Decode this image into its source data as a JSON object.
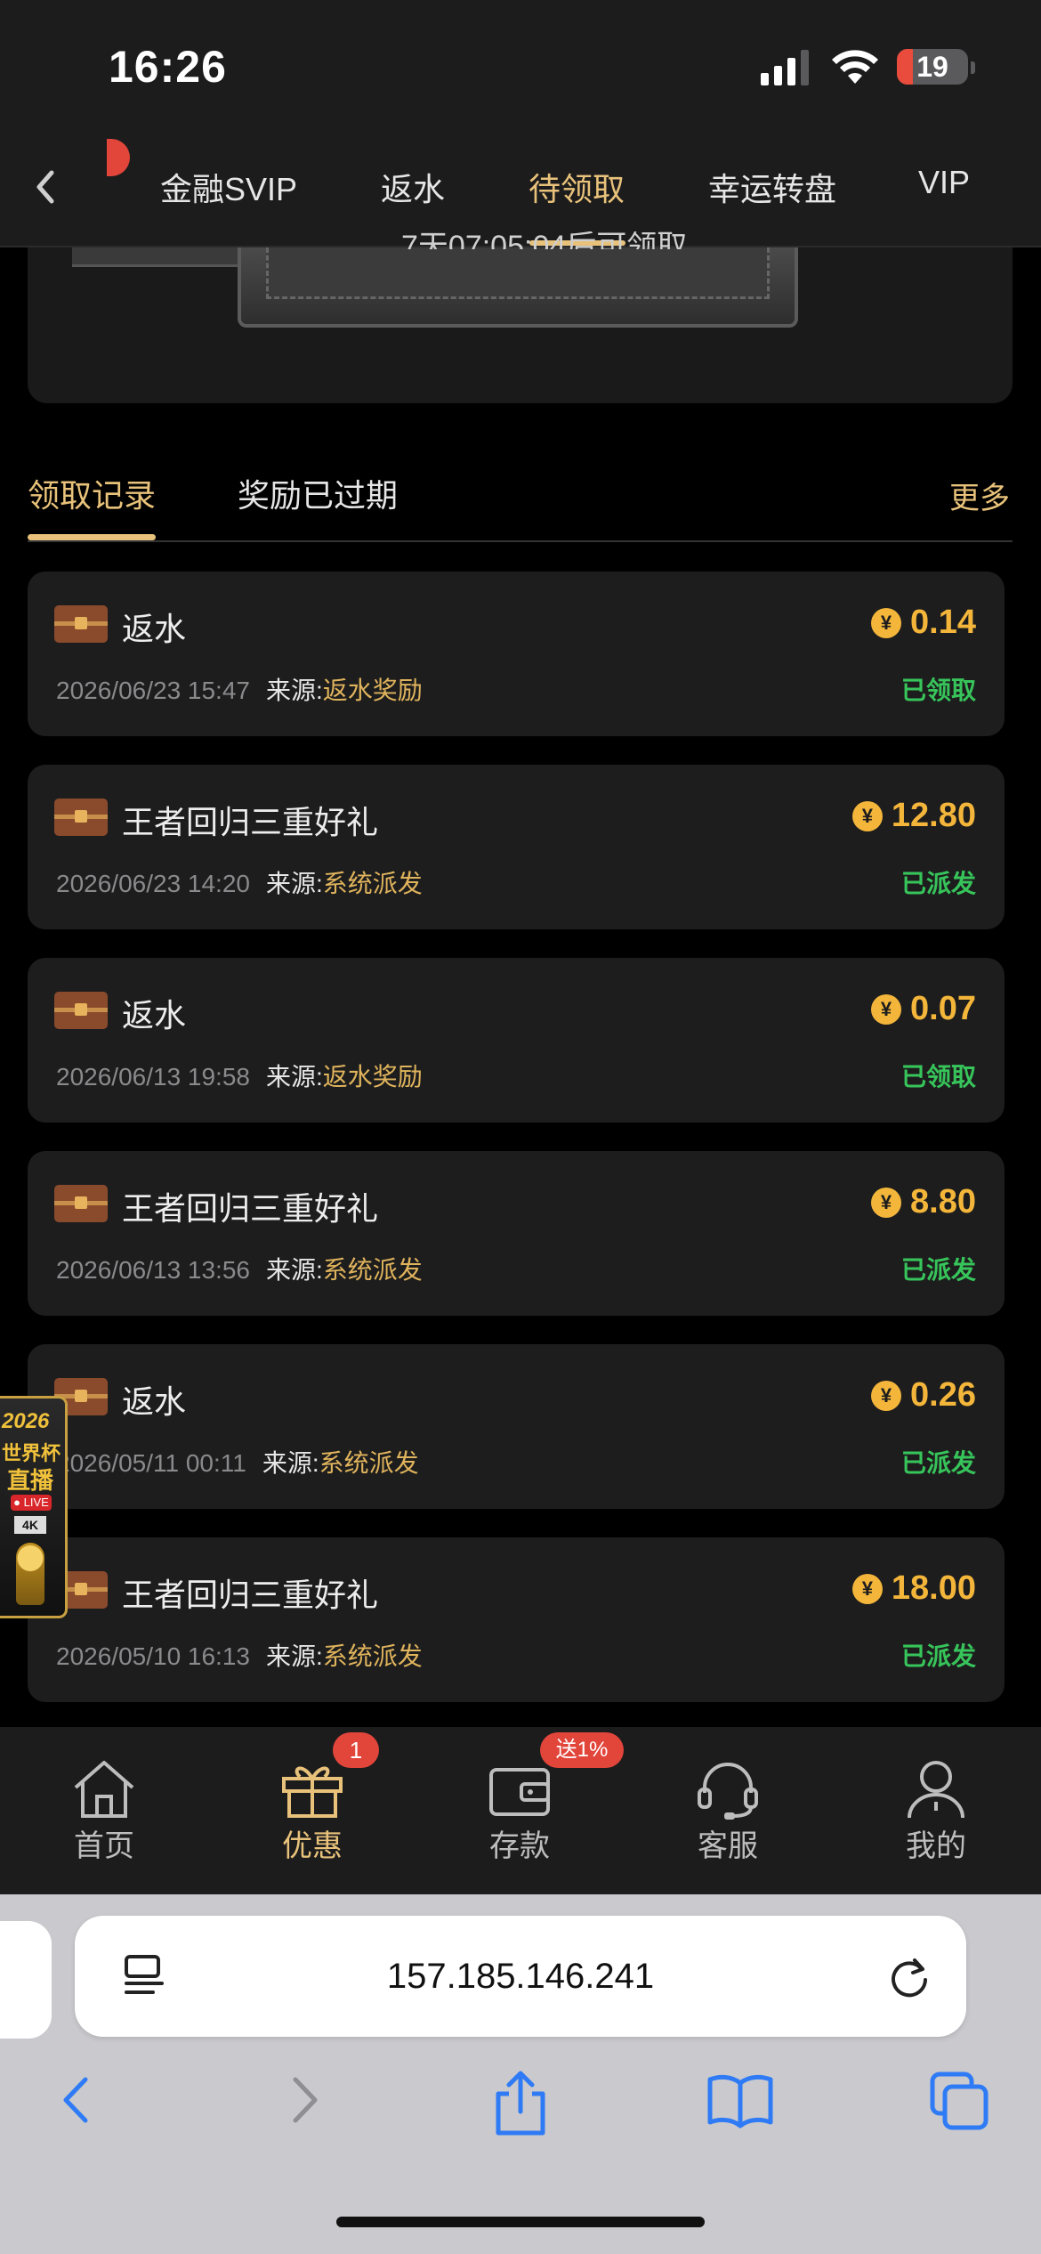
{
  "status_bar": {
    "time": "16:26",
    "battery": "19"
  },
  "top_nav": {
    "tabs": [
      {
        "label": "金融SVIP"
      },
      {
        "label": "返水"
      },
      {
        "label": "待领取"
      },
      {
        "label": "幸运转盘"
      },
      {
        "label": "VIP"
      }
    ],
    "active_index": 2
  },
  "hero": {
    "partial_text": "7天07:05:04后可领取"
  },
  "sub_tabs": {
    "tabs": [
      {
        "label": "领取记录"
      },
      {
        "label": "奖励已过期"
      }
    ],
    "more": "更多"
  },
  "records": [
    {
      "title": "返水",
      "date": "2026/06/23 15:47",
      "source_label": "来源:",
      "source": "返水奖励",
      "amount": "0.14",
      "status": "已领取"
    },
    {
      "title": "王者回归三重好礼",
      "date": "2026/06/23 14:20",
      "source_label": "来源:",
      "source": "系统派发",
      "amount": "12.80",
      "status": "已派发"
    },
    {
      "title": "返水",
      "date": "2026/06/13 19:58",
      "source_label": "来源:",
      "source": "返水奖励",
      "amount": "0.07",
      "status": "已领取"
    },
    {
      "title": "王者回归三重好礼",
      "date": "2026/06/13 13:56",
      "source_label": "来源:",
      "source": "系统派发",
      "amount": "8.80",
      "status": "已派发"
    },
    {
      "title": "返水",
      "date": "2026/05/11 00:11",
      "source_label": "来源:",
      "source": "系统派发",
      "amount": "0.26",
      "status": "已派发"
    },
    {
      "title": "王者回归三重好礼",
      "date": "2026/05/10 16:13",
      "source_label": "来源:",
      "source": "系统派发",
      "amount": "18.00",
      "status": "已派发"
    }
  ],
  "world_cup_badge": {
    "year": "2026",
    "line1": "世界杯",
    "line2": "直播",
    "live": "● LIVE",
    "quality": "4K"
  },
  "tab_bar": {
    "items": [
      {
        "label": "首页",
        "icon": "home-icon"
      },
      {
        "label": "优惠",
        "icon": "gift-icon"
      },
      {
        "label": "存款",
        "icon": "wallet-icon"
      },
      {
        "label": "客服",
        "icon": "headset-icon"
      },
      {
        "label": "我的",
        "icon": "user-icon"
      }
    ],
    "active_index": 1,
    "promo_badge": "1",
    "deposit_badge": "送1%"
  },
  "browser": {
    "url": "157.185.146.241"
  },
  "colors": {
    "accent_gold": "#e8c27a",
    "amount_orange": "#f4b63a",
    "status_green": "#37c45a",
    "badge_red": "#e2453a"
  }
}
